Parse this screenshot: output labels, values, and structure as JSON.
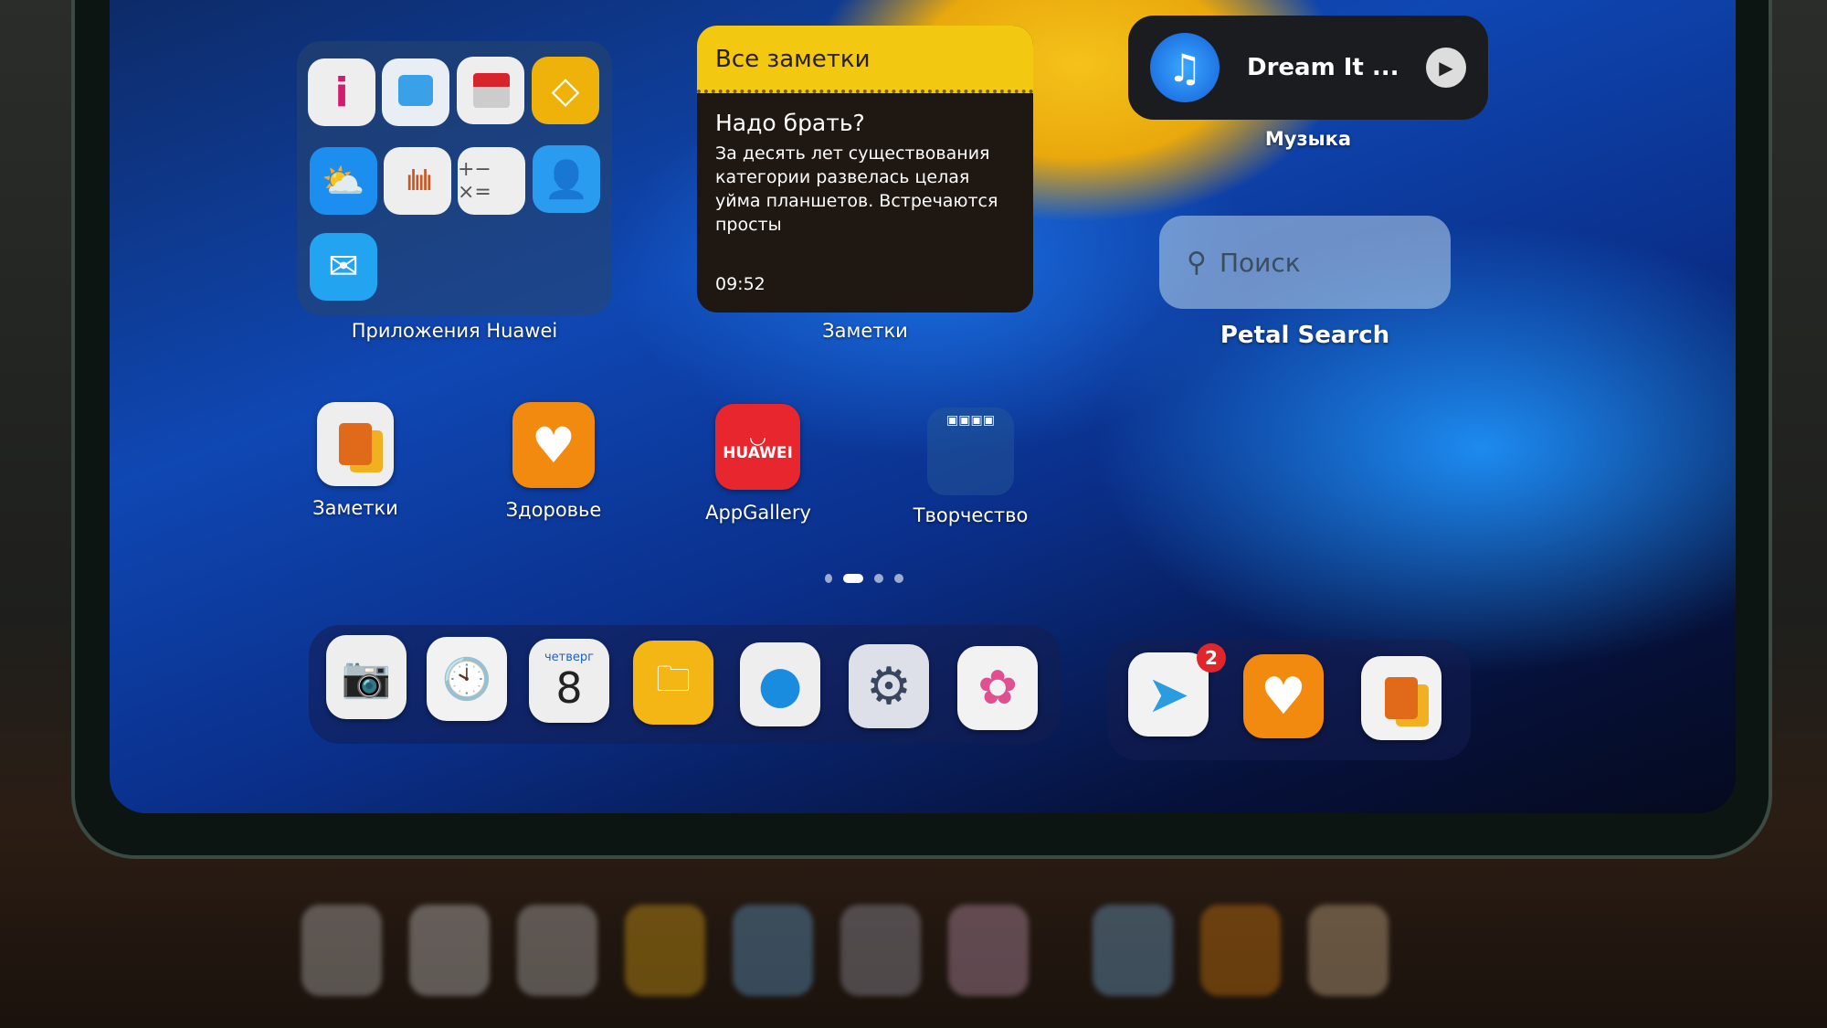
{
  "folder_huawei": {
    "label": "Приложения Huawei",
    "apps": [
      "tips-icon",
      "phone-clone-icon",
      "huawei-gift-icon",
      "membership-icon",
      "weather-icon",
      "recorder-icon",
      "calculator-icon",
      "contacts-icon",
      "email-icon"
    ]
  },
  "notes_widget": {
    "header": "Все заметки",
    "note_title": "Надо брать?",
    "note_text": "За десять лет существования категории развелась целая уйма планшетов. Встречаются просты",
    "time": "09:52",
    "label": "Заметки"
  },
  "music_widget": {
    "track": "Dream It ...",
    "label": "Музыка"
  },
  "search_widget": {
    "placeholder": "Поиск",
    "label": "Petal Search"
  },
  "home_apps": [
    {
      "label": "Заметки"
    },
    {
      "label": "Здоровье"
    },
    {
      "label": "AppGallery",
      "logo_text": "HUAWEI"
    },
    {
      "label": "Творчество"
    }
  ],
  "page_indicator": {
    "pages": 4,
    "current": 2
  },
  "dock": {
    "calendar_day": "четверг",
    "calendar_date": "8",
    "apps": [
      "camera-icon",
      "clock-icon",
      "calendar-icon",
      "files-icon",
      "browser-icon",
      "settings-icon",
      "gallery-icon"
    ],
    "recent": [
      {
        "name": "telegram-icon",
        "badge": "2"
      },
      {
        "name": "health-icon"
      },
      {
        "name": "notes-icon"
      }
    ]
  },
  "colors": {
    "notes_yellow": "#f2c811",
    "badge_red": "#e0262a",
    "appgallery_red": "#e8262d",
    "health_orange": "#f28a10"
  }
}
